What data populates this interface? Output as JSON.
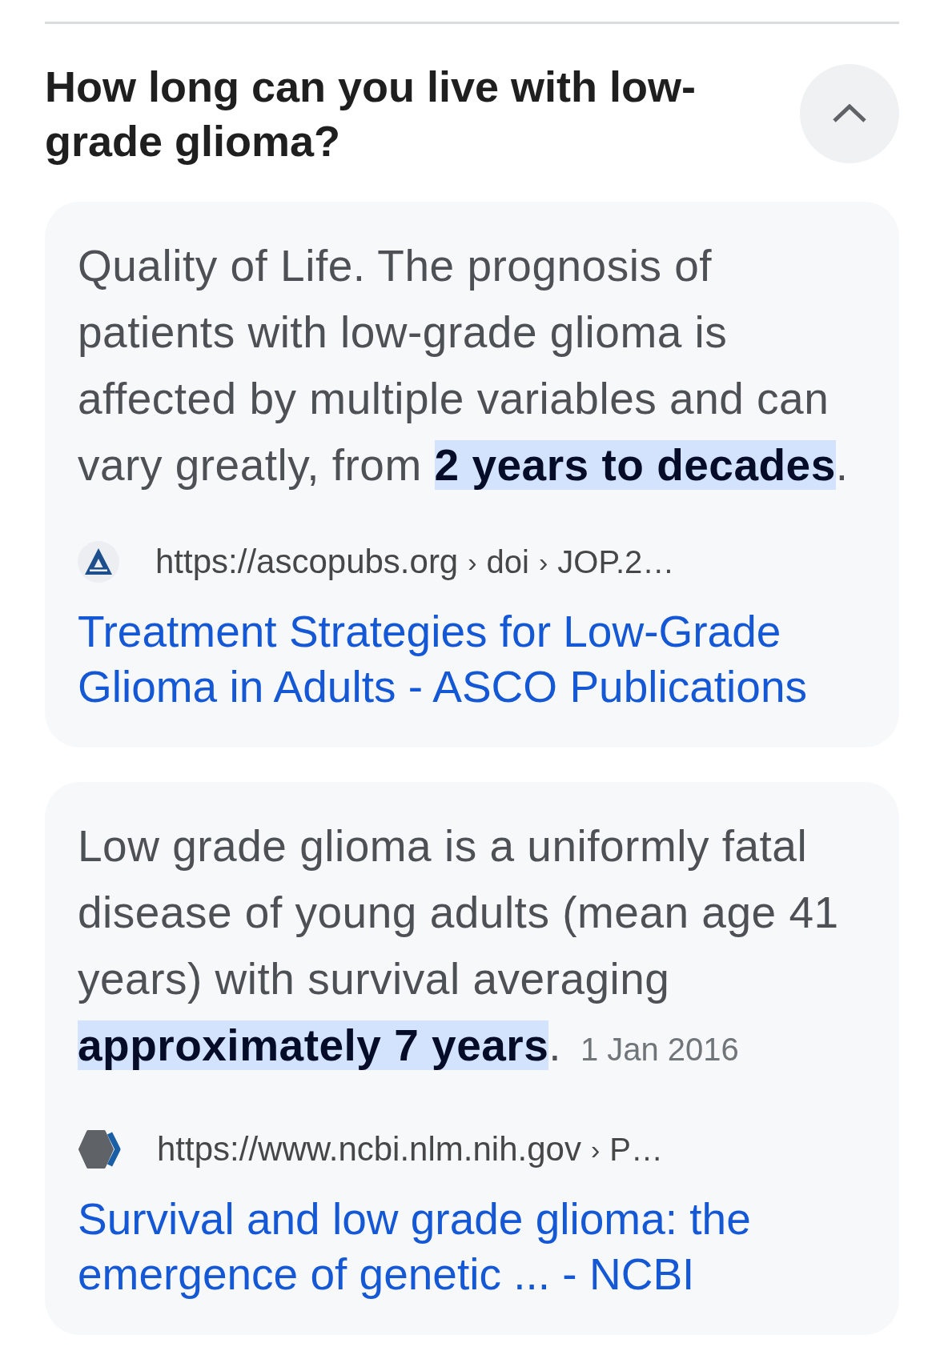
{
  "question": {
    "title": "How long can you live with low-grade glioma?",
    "expanded": true
  },
  "answers": [
    {
      "snippet": "Quality of Life. The prognosis of patients with low-grade glioma is affected by multiple variables and can vary greatly, from **2 years to decades**.",
      "source": {
        "kind": "triangle",
        "url": "https://ascopubs.org",
        "path": [
          {
            "separator": "›",
            "label": "doi"
          },
          {
            "separator": "›",
            "label": "JOP.2…"
          }
        ]
      },
      "title": "Treatment Strategies for Low-Grade Glioma in Adults - ASCO Publications"
    },
    {
      "snippet": "Low grade glioma is a uniformly fatal disease of young adults (mean age 41 years) with survival averaging **approximately 7 years**.",
      "date": "1 Jan 2016",
      "source": {
        "kind": "hexagon",
        "url": "https://www.ncbi.nlm.nih.gov",
        "path": [
          {
            "separator": "›",
            "label": "P…"
          }
        ]
      },
      "title": "Survival and low grade glioma: the emergence of genetic ... - NCBI"
    }
  ]
}
